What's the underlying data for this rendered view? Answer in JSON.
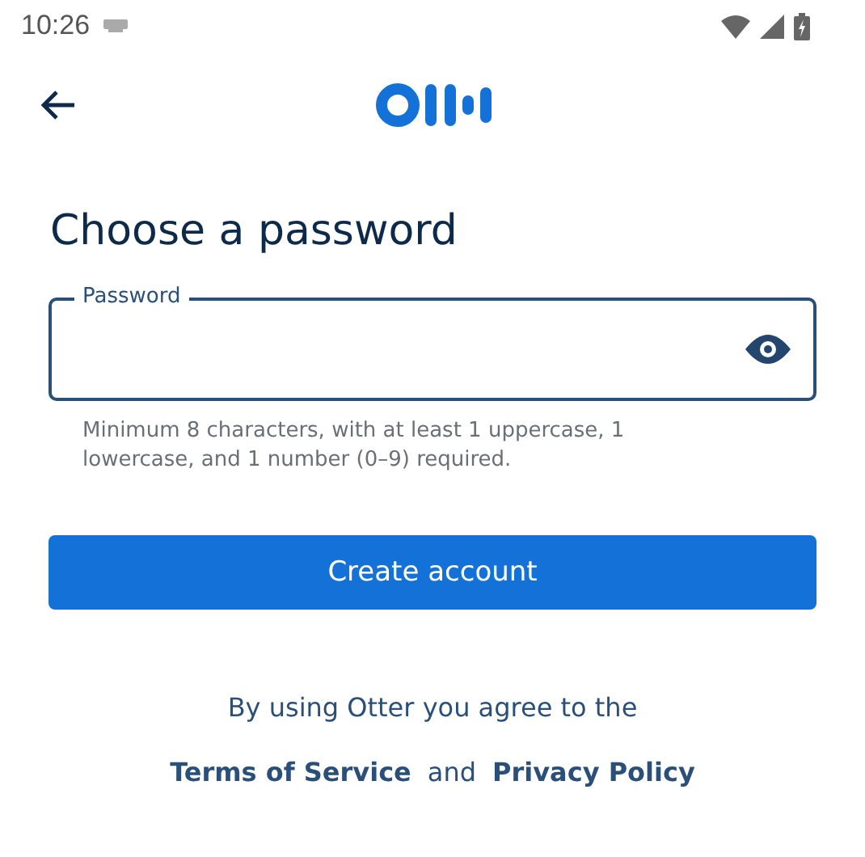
{
  "status_bar": {
    "time": "10:26"
  },
  "title": "Choose a password",
  "password_field": {
    "label": "Password"
  },
  "helper_text": "Minimum 8 characters, with at least 1 uppercase, 1 lowercase, and 1 number (0–9) required.",
  "primary_button": "Create account",
  "agreement": {
    "text": "By using Otter you agree to the",
    "links": [
      "Terms of Service",
      "Privacy Policy"
    ],
    "conjunction": "and"
  }
}
